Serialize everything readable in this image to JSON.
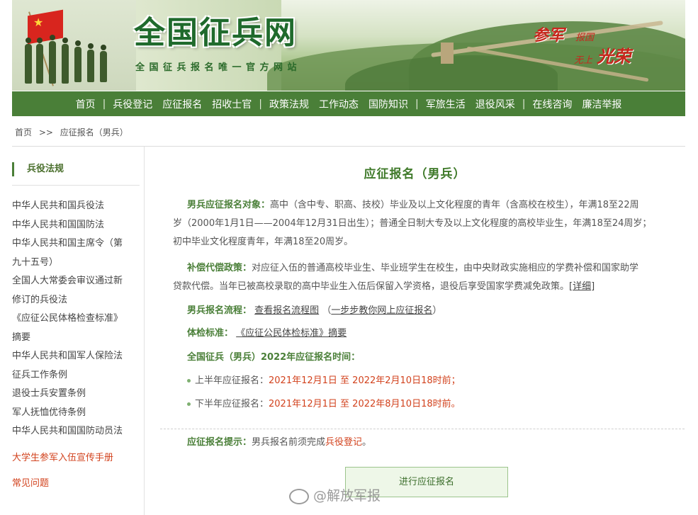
{
  "banner": {
    "brand": "全国征兵网",
    "subtitle": "全国征兵报名唯一官方网站",
    "slogan": {
      "l1": "参军",
      "l2": "报国",
      "l3": "无上",
      "l4": "光荣"
    }
  },
  "nav": {
    "items": [
      "首页",
      "兵役登记",
      "应征报名",
      "招收士官",
      "政策法规",
      "工作动态",
      "国防知识",
      "军旅生活",
      "退役风采",
      "在线咨询",
      "廉洁举报"
    ],
    "seps": [
      "|",
      "|",
      "|",
      "|",
      "|"
    ]
  },
  "breadcrumb": {
    "home": "首页",
    "sep": ">>",
    "current": "应征报名（男兵）"
  },
  "sidebar": {
    "title": "兵役法规",
    "links": [
      "中华人民共和国兵役法",
      "中华人民共和国国防法",
      "中华人民共和国主席令（第",
      "九十五号）",
      "全国人大常委会审议通过新",
      "修订的兵役法",
      "《应征公民体格检查标准》",
      "摘要",
      "中华人民共和国军人保险法",
      "征兵工作条例",
      "退役士兵安置条例",
      "军人抚恤优待条例",
      "中华人民共和国国防动员法"
    ],
    "handbook": "大学生参军入伍宣传手册",
    "faq": "常见问题"
  },
  "main": {
    "title": "应征报名（男兵）",
    "target_label": "男兵应征报名对象：",
    "target_text_1": "高中（含中专、职高、技校）毕业及以上文化程度的青年（含高校在校生），年满18至22周",
    "target_text_2": "岁（2000年1月1日——2004年12月31日出生）；普通全日制大专及以上文化程度的高校毕业生，年满18至24周岁；",
    "target_text_3": "初中毕业文化程度青年，年满18至20周岁。",
    "comp_label": "补偿代偿政策：",
    "comp_text_1": "对应征入伍的普通高校毕业生、毕业班学生在校生，由中央财政实施相应的学费补偿和国家助学",
    "comp_text_2": "贷款代偿。当年已被高校录取的高中毕业生入伍后保留入学资格，退役后享受国家学费减免政策。",
    "comp_link": "[详细]",
    "flow_label": "男兵报名流程：",
    "flow_link": "查看报名流程图",
    "flow_paren_open": "（",
    "flow_link2": "一步步教你网上应征报名",
    "flow_paren_close": "）",
    "exam_label": "体检标准：",
    "exam_link": "《应征公民体检标准》",
    "exam_suffix": "摘要",
    "time_label": "全国征兵（男兵）2022年应征报名时间：",
    "first_label": "上半年应征报名：",
    "first_value": "2021年12月1日 至 2022年2月10日18时前；",
    "second_label": "下半年应征报名：",
    "second_value": "2021年12月1日 至 2022年8月10日18时前。",
    "tip_label": "应征报名提示：",
    "tip_text": "男兵报名前须完成",
    "tip_link": "兵役登记",
    "tip_end": "。",
    "button": "进行应征报名"
  },
  "watermark": "@解放军报",
  "colors": {
    "nav_bg": "#4a7f38",
    "accent_green": "#4a7f38",
    "accent_red": "#d2421d"
  }
}
